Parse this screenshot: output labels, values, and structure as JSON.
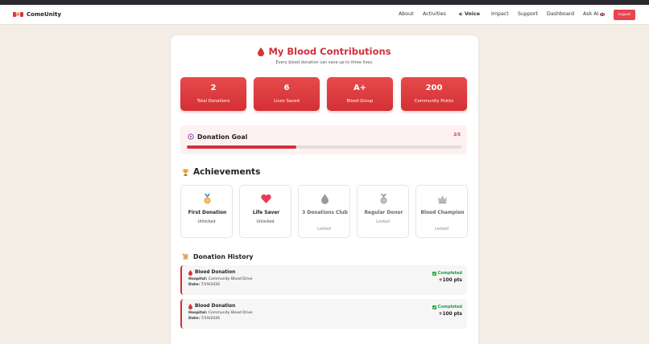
{
  "nav": {
    "brand": "ComeUnity",
    "items": [
      "About",
      "Activities",
      "Impact",
      "Support",
      "Dashboard"
    ],
    "voice_label": "Voice",
    "ask_ai": "Ask AI",
    "logout": "Logout"
  },
  "header": {
    "title": "My Blood Contributions",
    "subtitle": "Every blood donation can save up to three lives."
  },
  "stats": [
    {
      "value": "2",
      "label": "Total Donations"
    },
    {
      "value": "6",
      "label": "Lives Saved"
    },
    {
      "value": "A+",
      "label": "Blood Group"
    },
    {
      "value": "200",
      "label": "Community Points"
    }
  ],
  "goal": {
    "title": "Donation Goal",
    "count": "2/5",
    "progress": 0.4
  },
  "achievements": {
    "title": "Achievements",
    "items": [
      {
        "name": "First Donation",
        "status": "Unlocked",
        "icon": "medal-icon"
      },
      {
        "name": "Life Saver",
        "status": "Unlocked",
        "icon": "heart-icon"
      },
      {
        "name": "3 Donations Club",
        "status": "Locked",
        "icon": "drop-icon"
      },
      {
        "name": "Regular Donor",
        "status": "Locked",
        "icon": "medal-icon"
      },
      {
        "name": "Blood Champion",
        "status": "Locked",
        "icon": "crown-icon"
      }
    ]
  },
  "history": {
    "title": "Donation History",
    "hospital_label": "Hospital:",
    "date_label": "Date:",
    "items": [
      {
        "name": "Blood Donation",
        "hospital": "Community Blood Drive",
        "date": "7/19/2026",
        "status": "Completed",
        "points": "+100 pts"
      },
      {
        "name": "Blood Donation",
        "hospital": "Community Blood Drive",
        "date": "7/19/2026",
        "status": "Completed",
        "points": "+100 pts"
      }
    ]
  },
  "colors": {
    "accent": "#d22f3c",
    "background": "#f4ede6",
    "success": "#1e9e42"
  }
}
